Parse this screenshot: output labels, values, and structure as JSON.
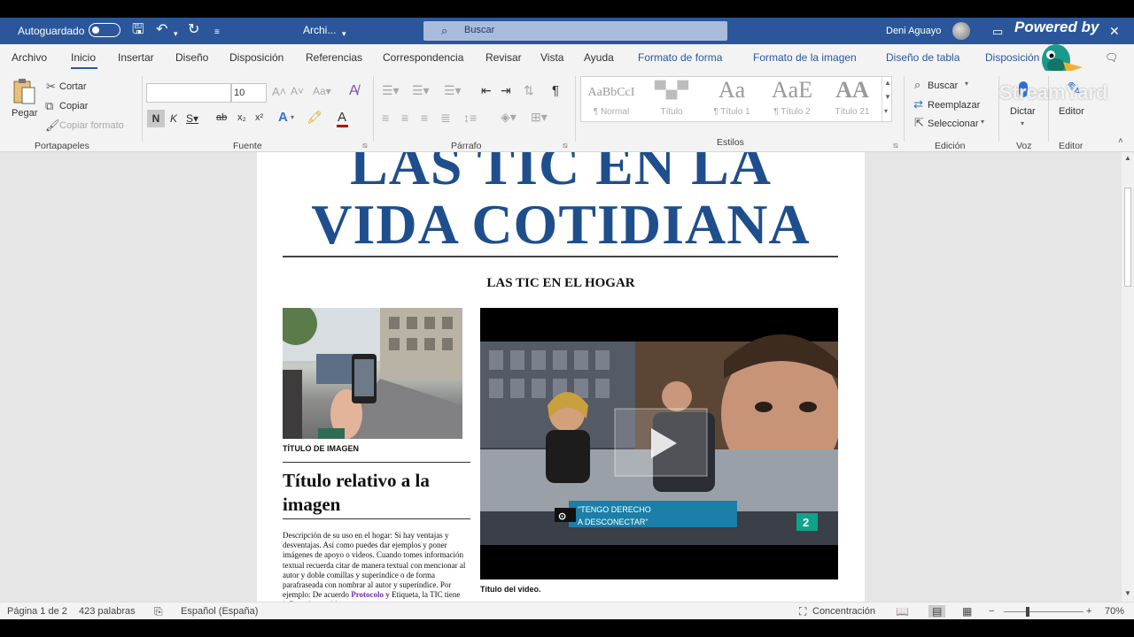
{
  "titlebar": {
    "autosave_label": "Autoguardado",
    "doc_name": "Archi...",
    "search_placeholder": "Buscar",
    "user_name": "Deni Aguayo",
    "overlay_text": "Powered by"
  },
  "menu": {
    "tabs": [
      "Archivo",
      "Inicio",
      "Insertar",
      "Diseño",
      "Disposición",
      "Referencias",
      "Correspondencia",
      "Revisar",
      "Vista",
      "Ayuda",
      "Formato de forma",
      "Formato de la imagen",
      "Diseño de tabla",
      "Disposición"
    ],
    "active": "Inicio"
  },
  "ribbon": {
    "clipboard": {
      "paste": "Pegar",
      "cut": "Cortar",
      "copy": "Copiar",
      "format_painter": "Copiar formato",
      "label": "Portapapeles"
    },
    "font": {
      "size": "10",
      "bold": "N",
      "italic": "K",
      "strike": "ab",
      "subscript": "x₂",
      "superscript": "x²",
      "label": "Fuente"
    },
    "paragraph": {
      "label": "Párrafo"
    },
    "styles": {
      "items": [
        {
          "preview": "AaBbCcI",
          "name": "¶ Normal"
        },
        {
          "preview": "▀▄▀",
          "name": "Título"
        },
        {
          "preview": "Aa",
          "name": "¶ Título 1"
        },
        {
          "preview": "AaE",
          "name": "¶ Título 2"
        },
        {
          "preview": "AA",
          "name": "Título 21"
        }
      ],
      "label": "Estilos"
    },
    "editing": {
      "find": "Buscar",
      "replace": "Reemplazar",
      "select": "Seleccionar",
      "label": "Edición"
    },
    "voice": {
      "dictate": "Dictar",
      "label": "Voz"
    },
    "editor": {
      "button": "Editor",
      "label": "Editor"
    },
    "watermark": "StreamYard"
  },
  "document": {
    "headline_line1": "LAS TIC EN LA",
    "headline_line2": "VIDA COTIDIANA",
    "subheading": "LAS TIC EN EL HOGAR",
    "image_caption": "TÍTULO DE IMAGEN",
    "image_title": "Título relativo a la imagen",
    "body_text": "Descripción de su uso en el hogar: Si hay ventajas y desventajas. Así como puedes dar ejemplos y poner imágenes de apoyo o videos. Cuando tomes información textual recuerda citar de manera textual con mencionar al autor y doble comillas y superíndice o de forma parafraseada con nombrar al autor y superíndice. Por ejemplo: De acuerdo",
    "body_link": "Protocolo y",
    "body_tail": "Etiqueta, la TIC tiene influencias positivas y",
    "video_banner_1": "\"TENGO DERECHO",
    "video_banner_2": "A DESCONECTAR\"",
    "video_channel": "2",
    "video_caption": "Título del video."
  },
  "status": {
    "page": "Página 1 de 2",
    "words": "423 palabras",
    "language": "Español (España)",
    "focus": "Concentración",
    "zoom": "70%"
  }
}
